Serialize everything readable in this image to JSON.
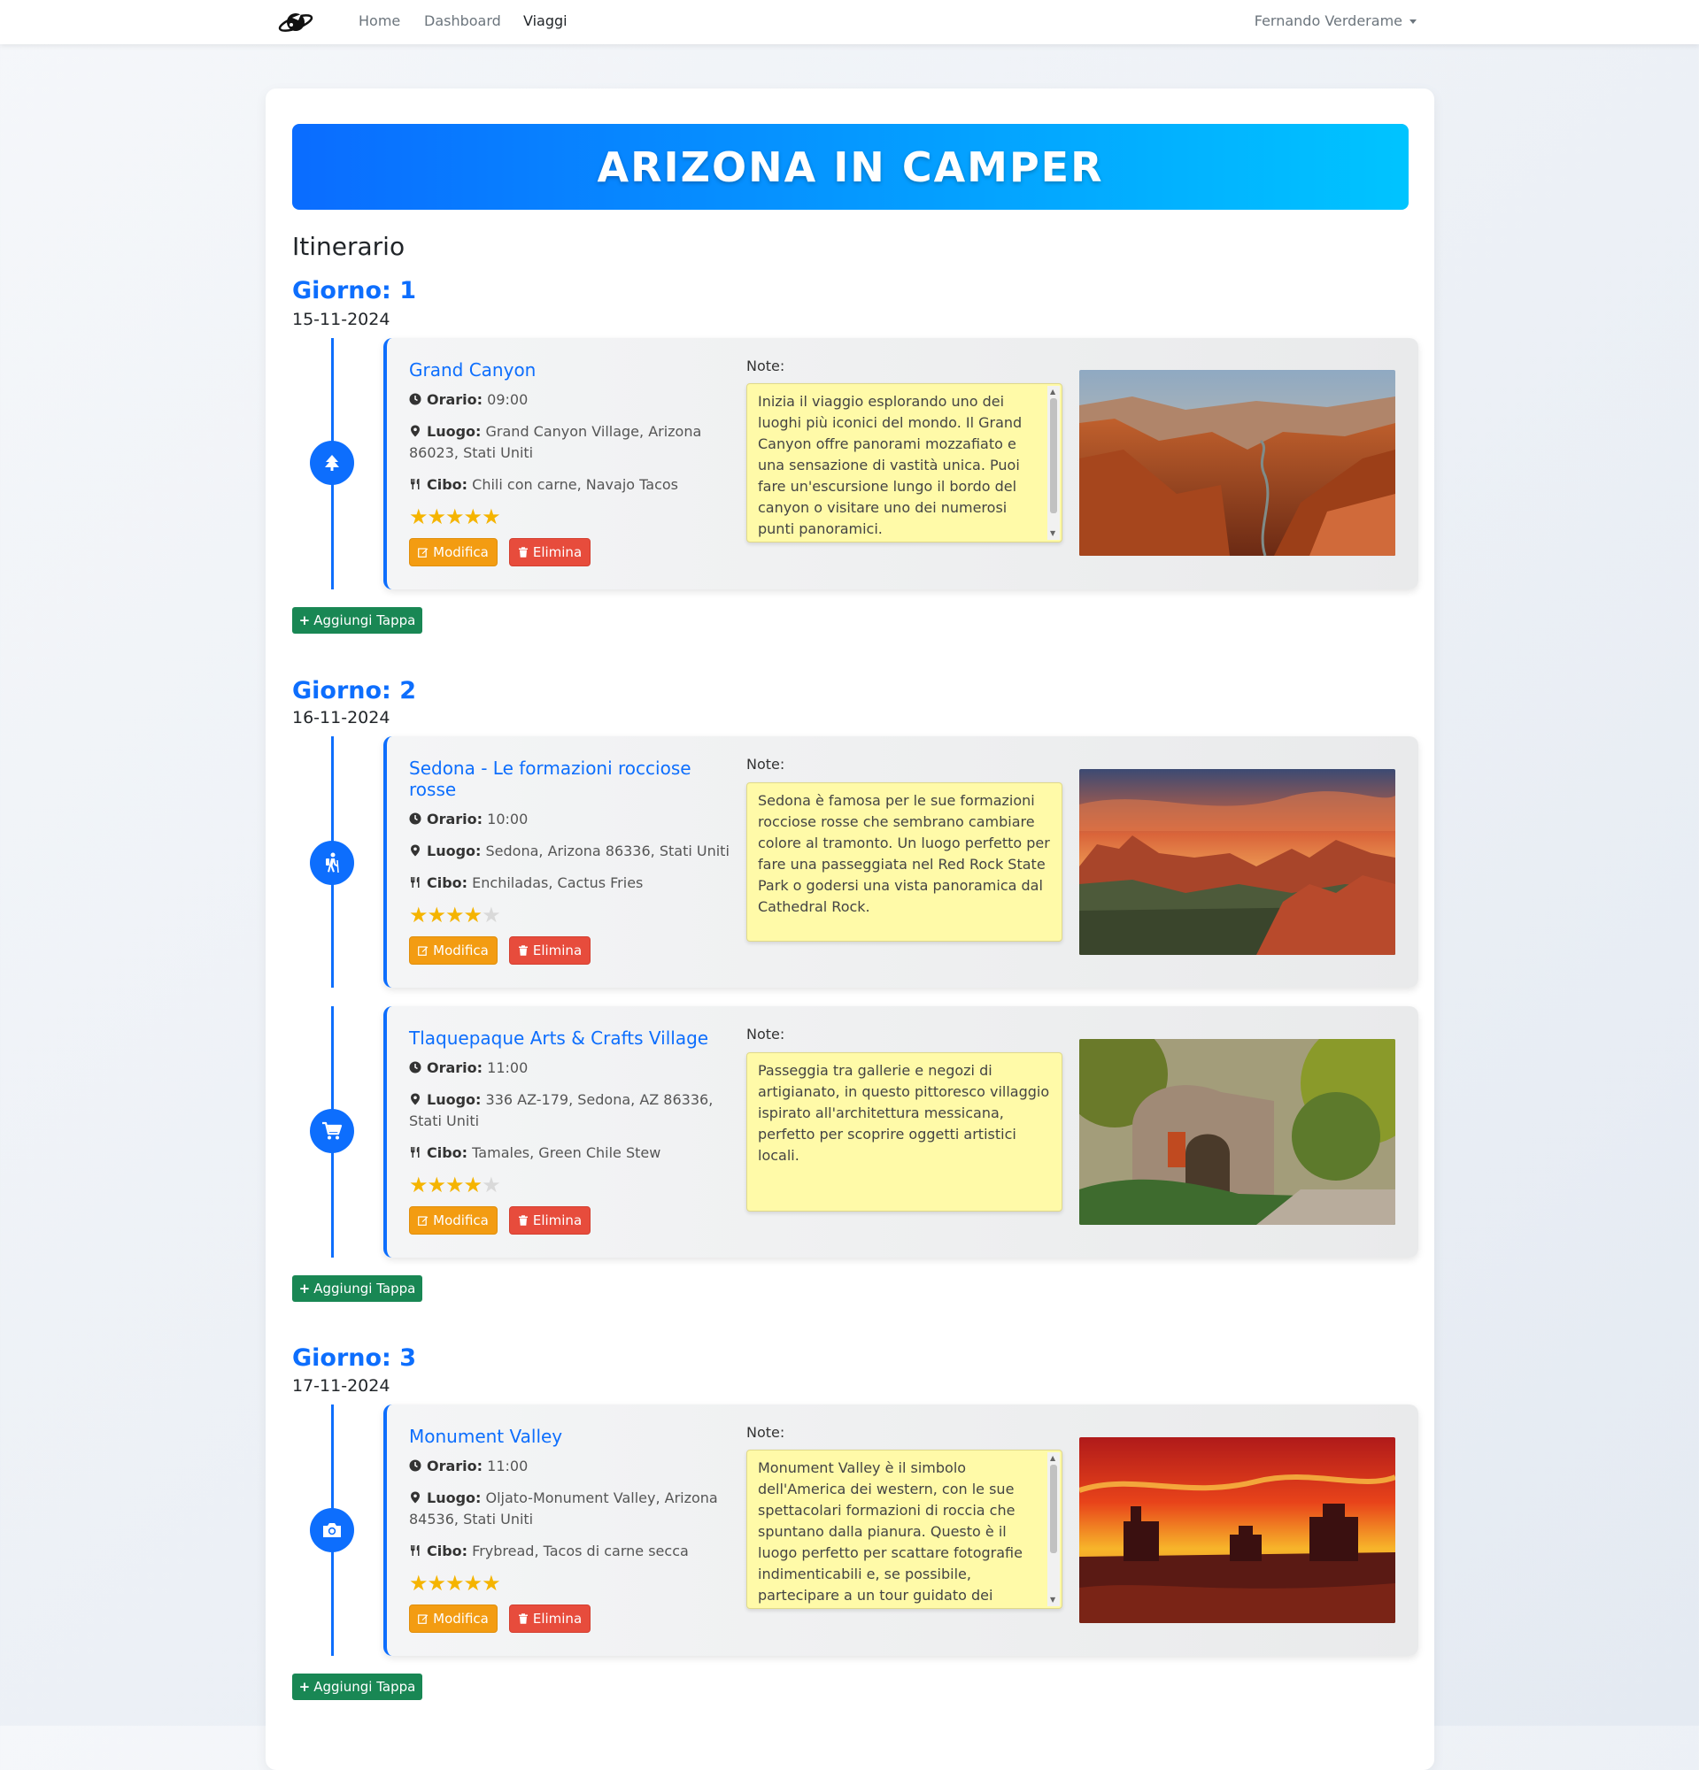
{
  "nav": {
    "links": [
      "Home",
      "Dashboard",
      "Viaggi"
    ],
    "user": "Fernando Verderame"
  },
  "trip": {
    "title": "ARIZONA IN CAMPER",
    "itinerary_label": "Itinerario",
    "notes_label": "Note:",
    "edit_label": "Modifica",
    "delete_label": "Elimina",
    "add_stop_label": "Aggiungi Tappa",
    "labels": {
      "time": "Orario:",
      "place": "Luogo:",
      "food": "Cibo:"
    }
  },
  "days": [
    {
      "title": "Giorno: 1",
      "date": "15-11-2024",
      "stops": [
        {
          "name": "Grand Canyon",
          "icon": "tree-icon",
          "time": "09:00",
          "place": "Grand Canyon Village, Arizona 86023, Stati Uniti",
          "food": "Chili con carne, Navajo Tacos",
          "rating": 5,
          "note": "Inizia il viaggio esplorando uno dei luoghi più iconici del mondo. Il Grand Canyon offre panorami mozzafiato e una sensazione di vastità unica. Puoi fare un'escursione lungo il bordo del canyon o visitare uno dei numerosi punti panoramici."
        }
      ]
    },
    {
      "title": "Giorno: 2",
      "date": "16-11-2024",
      "stops": [
        {
          "name": "Sedona - Le formazioni rocciose rosse",
          "icon": "hiking-icon",
          "time": "10:00",
          "place": "Sedona, Arizona 86336, Stati Uniti",
          "food": "Enchiladas, Cactus Fries",
          "rating": 4,
          "note": "Sedona è famosa per le sue formazioni rocciose rosse che sembrano cambiare colore al tramonto. Un luogo perfetto per fare una passeggiata nel Red Rock State Park o godersi una vista panoramica dal Cathedral Rock."
        },
        {
          "name": "Tlaquepaque Arts & Crafts Village",
          "icon": "cart-icon",
          "time": "11:00",
          "place": "336 AZ-179, Sedona, AZ 86336, Stati Uniti",
          "food": "Tamales, Green Chile Stew",
          "rating": 4,
          "note": "Passeggia tra gallerie e negozi di artigianato, in questo pittoresco villaggio ispirato all'architettura messicana, perfetto per scoprire oggetti artistici locali."
        }
      ]
    },
    {
      "title": "Giorno: 3",
      "date": "17-11-2024",
      "stops": [
        {
          "name": "Monument Valley",
          "icon": "camera-icon",
          "time": "11:00",
          "place": "Oljato-Monument Valley, Arizona 84536, Stati Uniti",
          "food": "Frybread, Tacos di carne secca",
          "rating": 5,
          "note": "Monument Valley è il simbolo dell'America dei western, con le sue spettacolari formazioni di roccia che spuntano dalla pianura. Questo è il luogo perfetto per scattare fotografie indimenticabili e, se possibile, partecipare a un tour guidato dei"
        }
      ]
    }
  ]
}
